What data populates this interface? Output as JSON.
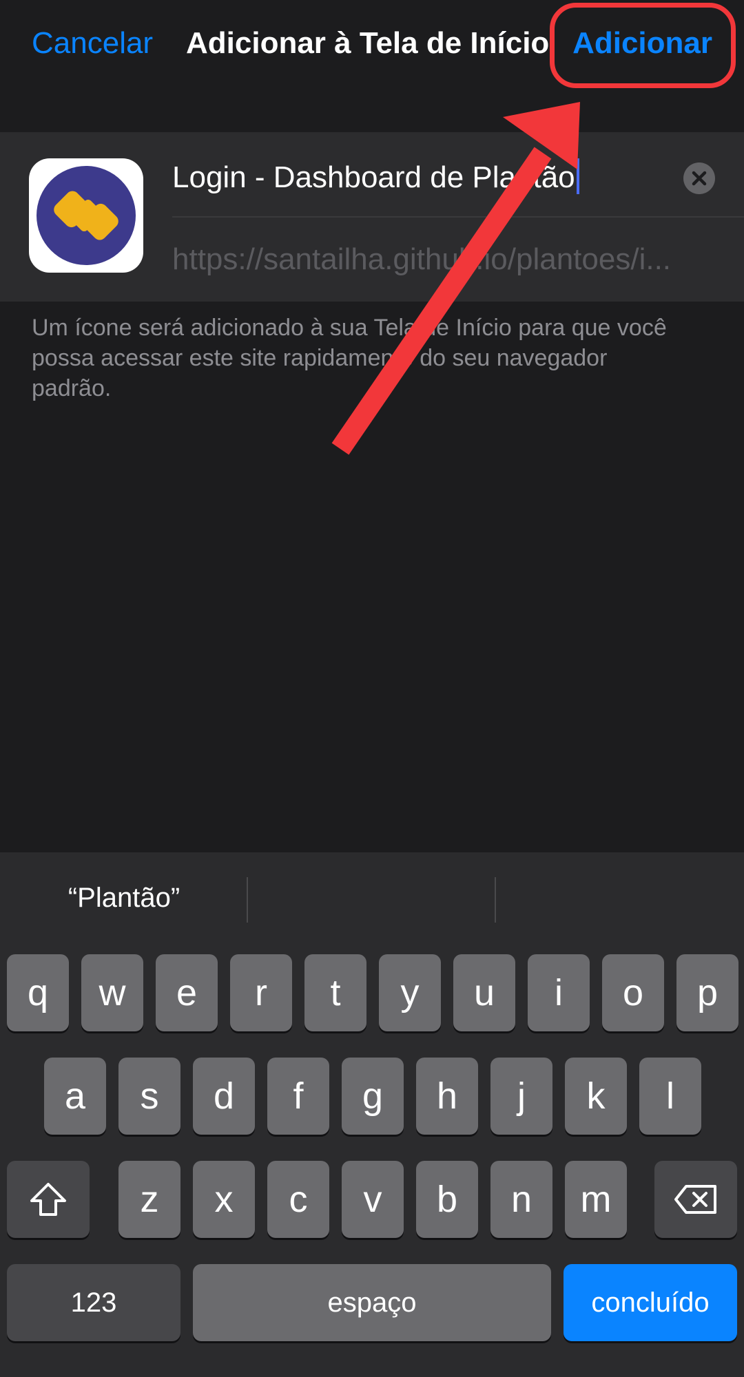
{
  "nav": {
    "cancel": "Cancelar",
    "title": "Adicionar à Tela de Início",
    "add": "Adicionar"
  },
  "bookmark": {
    "title_value": "Login - Dashboard de Plantão",
    "url": "https://santailha.github.io/plantoes/i...",
    "clear_icon": "clear-circle-icon",
    "app_icon": "app-logo-icon"
  },
  "hint": "Um ícone será adicionado à sua Tela de Início para que você possa acessar este site rapidamente do seu navegador padrão.",
  "keyboard": {
    "suggestions": [
      "“Plantão”",
      "",
      ""
    ],
    "row1": [
      "q",
      "w",
      "e",
      "r",
      "t",
      "y",
      "u",
      "i",
      "o",
      "p"
    ],
    "row2": [
      "a",
      "s",
      "d",
      "f",
      "g",
      "h",
      "j",
      "k",
      "l"
    ],
    "row3": [
      "z",
      "x",
      "c",
      "v",
      "b",
      "n",
      "m"
    ],
    "numbers_key": "123",
    "space_key": "espaço",
    "done_key": "concluído",
    "shift_icon": "shift-icon",
    "backspace_icon": "backspace-icon"
  },
  "colors": {
    "accent": "#0a84ff",
    "annotation": "#f2373a",
    "background": "#1c1c1e",
    "card": "#2c2c2e",
    "logo_purple": "#3d3a8c",
    "logo_yellow": "#f0b21a"
  }
}
